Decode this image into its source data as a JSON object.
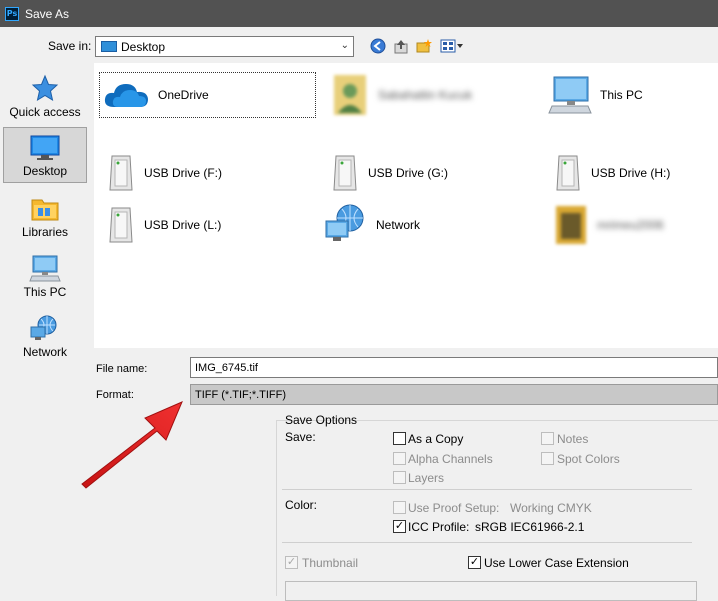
{
  "window": {
    "title": "Save As",
    "app_icon": "Ps"
  },
  "toolbar": {
    "save_in_label": "Save in:",
    "location": "Desktop",
    "icons": [
      "back-icon",
      "up-folder-icon",
      "new-folder-icon",
      "view-menu-icon"
    ]
  },
  "places": [
    {
      "label": "Quick access",
      "icon": "quick-access-icon",
      "selected": false
    },
    {
      "label": "Desktop",
      "icon": "desktop-icon",
      "selected": true
    },
    {
      "label": "Libraries",
      "icon": "libraries-icon",
      "selected": false
    },
    {
      "label": "This PC",
      "icon": "this-pc-icon",
      "selected": false
    },
    {
      "label": "Network",
      "icon": "network-icon",
      "selected": false
    }
  ],
  "files": [
    {
      "label": "OneDrive",
      "icon": "onedrive-icon"
    },
    {
      "label": "Sabahattin Kucuk",
      "icon": "user-folder-icon",
      "blurred": true
    },
    {
      "label": "This PC",
      "icon": "this-pc-icon"
    },
    {
      "label": "USB Drive (F:)",
      "icon": "usb-drive-icon"
    },
    {
      "label": "USB Drive (G:)",
      "icon": "usb-drive-icon"
    },
    {
      "label": "USB Drive (H:)",
      "icon": "usb-drive-icon"
    },
    {
      "label": "USB Drive (L:)",
      "icon": "usb-drive-icon"
    },
    {
      "label": "Network",
      "icon": "network-icon"
    },
    {
      "label": "mrimeu2006",
      "icon": "folder-icon",
      "blurred": true
    }
  ],
  "filename": {
    "label": "File name:",
    "value": "IMG_6745.tif"
  },
  "format": {
    "label": "Format:",
    "value": "TIFF (*.TIF;*.TIFF)"
  },
  "save_options": {
    "heading": "Save Options",
    "save_label": "Save:",
    "as_a_copy": "As a Copy",
    "notes": "Notes",
    "alpha_channels": "Alpha Channels",
    "spot_colors": "Spot Colors",
    "layers": "Layers",
    "color_label": "Color:",
    "use_proof_setup": "Use Proof Setup:",
    "proof_value": "Working CMYK",
    "icc_profile": "ICC Profile:",
    "icc_value": "sRGB IEC61966-2.1",
    "thumbnail": "Thumbnail",
    "lower_case_ext": "Use Lower Case Extension"
  },
  "colors": {
    "titlebar": "#525252",
    "annotation_arrow": "#e02020"
  }
}
